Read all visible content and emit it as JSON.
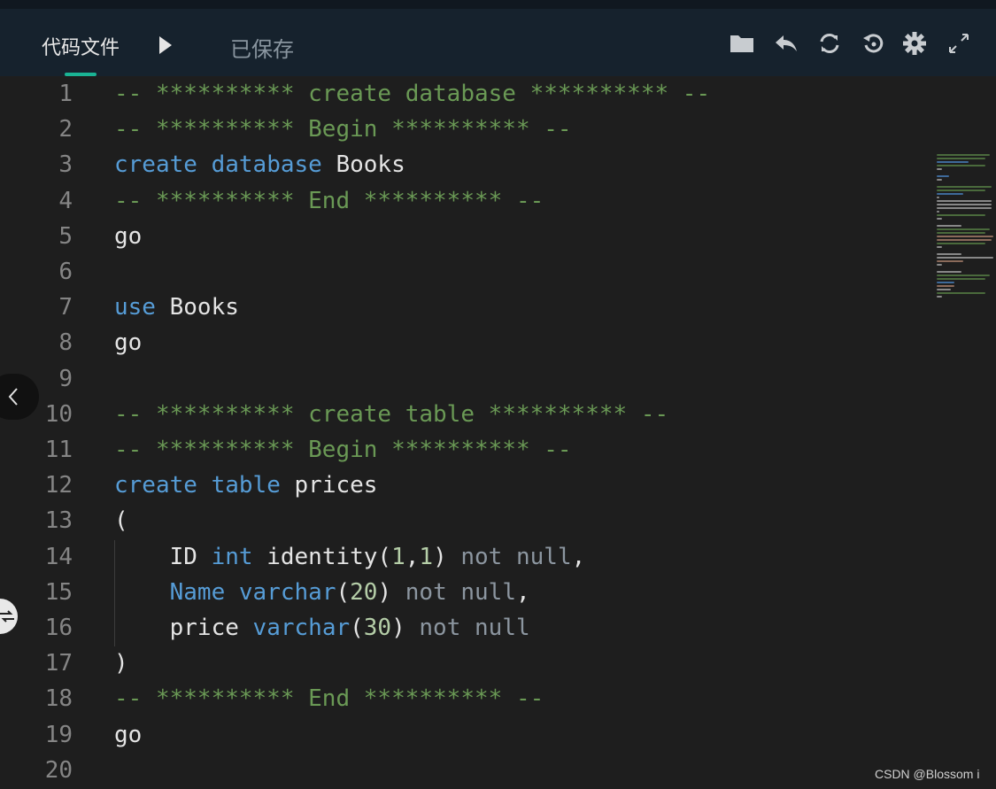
{
  "toolbar": {
    "file_tab": "代码文件",
    "status": "已保存",
    "icons": [
      "folder-icon",
      "undo-icon",
      "sync-icon",
      "history-icon",
      "settings-icon",
      "fullscreen-icon"
    ]
  },
  "colors": {
    "comment": "#6a9955",
    "keyword": "#569cd6",
    "number": "#b5cea8",
    "text": "#e4e4e4",
    "accent": "#1ab394"
  },
  "editor": {
    "lines": [
      {
        "n": "1",
        "tokens": [
          {
            "t": "-- ********** create database ********** --",
            "c": "comment"
          }
        ]
      },
      {
        "n": "2",
        "tokens": [
          {
            "t": "-- ********** Begin ********** --",
            "c": "comment"
          }
        ]
      },
      {
        "n": "3",
        "tokens": [
          {
            "t": "create",
            "c": "kw"
          },
          {
            "t": " ",
            "c": "plain"
          },
          {
            "t": "database",
            "c": "kw"
          },
          {
            "t": " Books",
            "c": "plain"
          }
        ]
      },
      {
        "n": "4",
        "tokens": [
          {
            "t": "-- ********** End ********** --",
            "c": "comment"
          }
        ]
      },
      {
        "n": "5",
        "tokens": [
          {
            "t": "go",
            "c": "plain"
          }
        ]
      },
      {
        "n": "6",
        "tokens": []
      },
      {
        "n": "7",
        "tokens": [
          {
            "t": "use",
            "c": "kw"
          },
          {
            "t": " Books",
            "c": "plain"
          }
        ]
      },
      {
        "n": "8",
        "tokens": [
          {
            "t": "go",
            "c": "plain"
          }
        ]
      },
      {
        "n": "9",
        "tokens": []
      },
      {
        "n": "10",
        "tokens": [
          {
            "t": "-- ********** create table ********** --",
            "c": "comment"
          }
        ]
      },
      {
        "n": "11",
        "tokens": [
          {
            "t": "-- ********** Begin ********** --",
            "c": "comment"
          }
        ]
      },
      {
        "n": "12",
        "tokens": [
          {
            "t": "create",
            "c": "kw"
          },
          {
            "t": " ",
            "c": "plain"
          },
          {
            "t": "table",
            "c": "kw"
          },
          {
            "t": " prices",
            "c": "plain"
          }
        ]
      },
      {
        "n": "13",
        "tokens": [
          {
            "t": "(",
            "c": "plain"
          }
        ]
      },
      {
        "n": "14",
        "tokens": [
          {
            "t": "    ID ",
            "c": "plain"
          },
          {
            "t": "int",
            "c": "kw"
          },
          {
            "t": " identity(",
            "c": "plain"
          },
          {
            "t": "1",
            "c": "num"
          },
          {
            "t": ",",
            "c": "plain"
          },
          {
            "t": "1",
            "c": "num"
          },
          {
            "t": ") ",
            "c": "plain"
          },
          {
            "t": "not null",
            "c": "gray"
          },
          {
            "t": ",",
            "c": "plain"
          }
        ]
      },
      {
        "n": "15",
        "tokens": [
          {
            "t": "    ",
            "c": "plain"
          },
          {
            "t": "Name",
            "c": "kw"
          },
          {
            "t": " ",
            "c": "plain"
          },
          {
            "t": "varchar",
            "c": "kw"
          },
          {
            "t": "(",
            "c": "plain"
          },
          {
            "t": "20",
            "c": "num"
          },
          {
            "t": ") ",
            "c": "plain"
          },
          {
            "t": "not null",
            "c": "gray"
          },
          {
            "t": ",",
            "c": "plain"
          }
        ]
      },
      {
        "n": "16",
        "tokens": [
          {
            "t": "    price ",
            "c": "plain"
          },
          {
            "t": "varchar",
            "c": "kw"
          },
          {
            "t": "(",
            "c": "plain"
          },
          {
            "t": "30",
            "c": "num"
          },
          {
            "t": ") ",
            "c": "plain"
          },
          {
            "t": "not null",
            "c": "gray"
          }
        ]
      },
      {
        "n": "17",
        "tokens": [
          {
            "t": ")",
            "c": "plain"
          }
        ]
      },
      {
        "n": "18",
        "tokens": [
          {
            "t": "-- ********** End ********** --",
            "c": "comment"
          }
        ]
      },
      {
        "n": "19",
        "tokens": [
          {
            "t": "go",
            "c": "plain"
          }
        ]
      },
      {
        "n": "20",
        "tokens": []
      }
    ]
  },
  "watermark": "CSDN @Blossom i"
}
